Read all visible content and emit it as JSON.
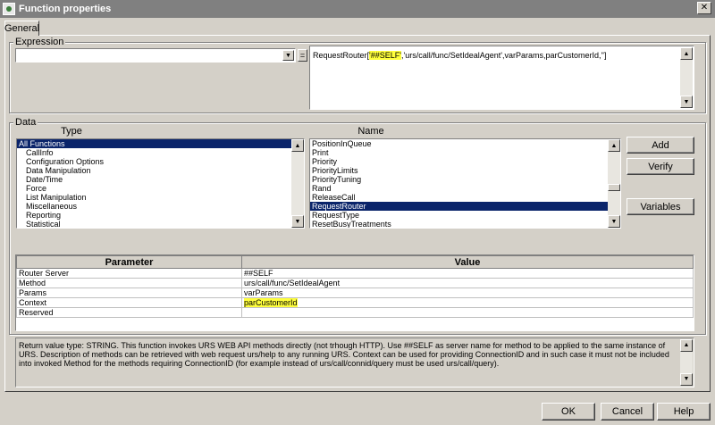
{
  "window": {
    "title": "Function properties",
    "close_label": "✕"
  },
  "tabs": [
    {
      "label": "General"
    }
  ],
  "expression": {
    "group_label": "Expression",
    "combo_value": "",
    "equals_label": "=",
    "text_prefix": "RequestRouter[",
    "text_highlight": "'##SELF'",
    "text_suffix": ",'urs/call/func/SetIdealAgent',varParams,parCustomerId,'']"
  },
  "data": {
    "group_label": "Data",
    "type_header": "Type",
    "name_header": "Name",
    "types": [
      {
        "label": "All Functions",
        "selected": true,
        "indent": false
      },
      {
        "label": "CallInfo",
        "selected": false,
        "indent": true
      },
      {
        "label": "Configuration Options",
        "selected": false,
        "indent": true
      },
      {
        "label": "Data Manipulation",
        "selected": false,
        "indent": true
      },
      {
        "label": "Date/Time",
        "selected": false,
        "indent": true
      },
      {
        "label": "Force",
        "selected": false,
        "indent": true
      },
      {
        "label": "List Manipulation",
        "selected": false,
        "indent": true
      },
      {
        "label": "Miscellaneous",
        "selected": false,
        "indent": true
      },
      {
        "label": "Reporting",
        "selected": false,
        "indent": true
      },
      {
        "label": "Statistical",
        "selected": false,
        "indent": true
      }
    ],
    "names": [
      {
        "label": "PositionInQueue",
        "selected": false
      },
      {
        "label": "Print",
        "selected": false
      },
      {
        "label": "Priority",
        "selected": false
      },
      {
        "label": "PriorityLimits",
        "selected": false
      },
      {
        "label": "PriorityTuning",
        "selected": false
      },
      {
        "label": "Rand",
        "selected": false
      },
      {
        "label": "ReleaseCall",
        "selected": false
      },
      {
        "label": "RequestRouter",
        "selected": true
      },
      {
        "label": "RequestType",
        "selected": false
      },
      {
        "label": "ResetBusyTreatments",
        "selected": false
      }
    ],
    "buttons": {
      "add": "Add",
      "verify": "Verify",
      "variables": "Variables"
    }
  },
  "params_table": {
    "headers": [
      "Parameter",
      "Value"
    ],
    "rows": [
      {
        "param": "Router Server",
        "value": "##SELF",
        "highlight": false
      },
      {
        "param": "Method",
        "value": "urs/call/func/SetIdealAgent",
        "highlight": false
      },
      {
        "param": "Params",
        "value": "varParams",
        "highlight": false
      },
      {
        "param": "Context",
        "value": "parCustomerId",
        "highlight": true
      },
      {
        "param": "Reserved",
        "value": "",
        "highlight": false
      }
    ]
  },
  "description": "Return value type: STRING. This function invokes URS WEB API methods directly (not trhough HTTP). Use ##SELF as server name for method to be applied to the same instance of URS. Description of methods can be retrieved with web request urs/help to any running URS. Context can be used for providing ConnectionID and in such case it must not be included into invoked Method for the methods requiring ConnectionID (for example instead of urs/call/connid/query must be used urs/call/query).",
  "footer": {
    "ok": "OK",
    "cancel": "Cancel",
    "help": "Help"
  },
  "colors": {
    "selection": "#0a246a",
    "highlight": "#ffff3c",
    "titlebar": "#808080"
  }
}
